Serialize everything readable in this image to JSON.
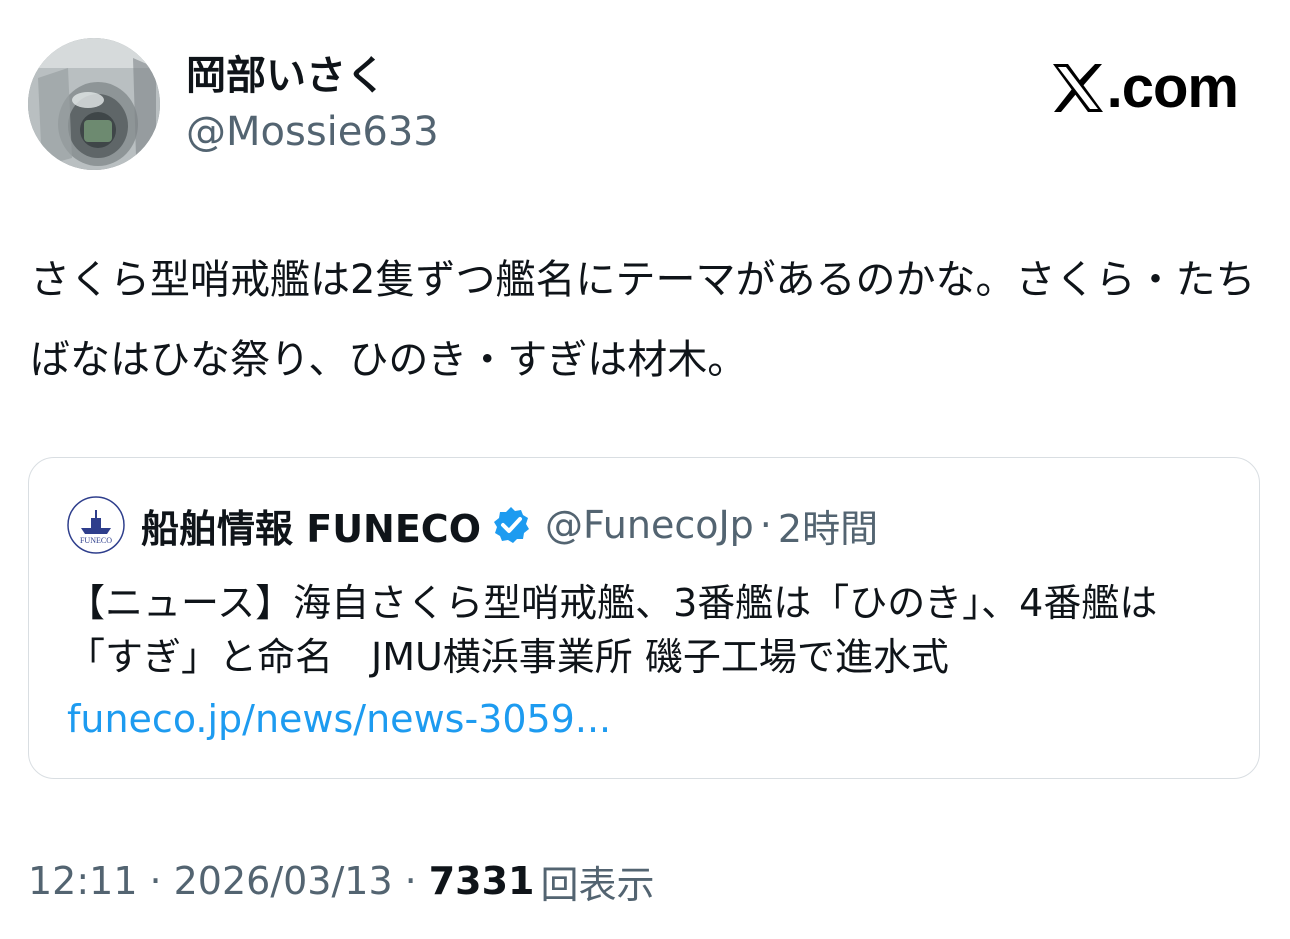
{
  "author": {
    "display_name": "岡部いさく",
    "handle": "@Mossie633",
    "avatar_icon": "avatar-cockpit-photo"
  },
  "brand": {
    "icon": "x-logo-icon",
    "suffix": ".com"
  },
  "tweet": {
    "text": "さくら型哨戒艦は2隻ずつ艦名にテーマがあるのかな。さくら・たちばなはひな祭り、ひのき・すぎは材木。"
  },
  "quote": {
    "display_name": "船舶情報 FUNECO",
    "verified_icon": "verified-badge-icon",
    "verified_color": "#1d9bf0",
    "handle": "@FunecoJp",
    "separator": "·",
    "time": "2時間",
    "avatar_text": "FUNECO",
    "body": "【ニュース】海自さくら型哨戒艦、3番艦は「ひのき」、4番艦は「すぎ」と命名　JMU横浜事業所 磯子工場で進水式",
    "link": "funeco.jp/news/news-3059..."
  },
  "meta": {
    "time": "12:11",
    "separator": "·",
    "date": "2026/03/13",
    "views_count": "7331",
    "views_label": "回表示"
  },
  "colors": {
    "text": "#0f1419",
    "secondary": "#536471",
    "link": "#1d9bf0",
    "border": "#d9dee2"
  }
}
